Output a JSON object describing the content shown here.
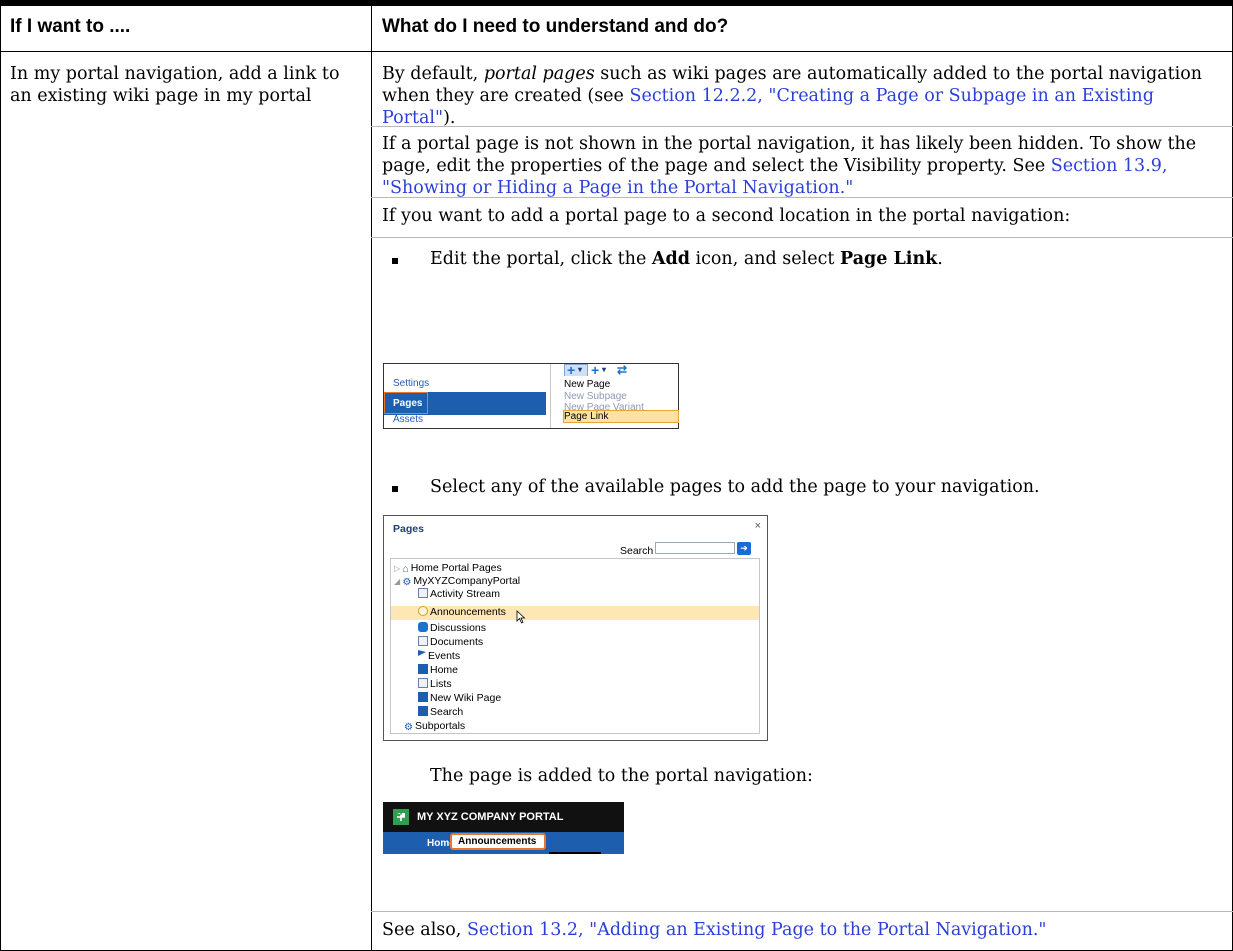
{
  "table": {
    "col1_header": "If I want to ....",
    "col2_header": "What do I need to understand and do?",
    "left_cell": "In my portal navigation, add a link to an existing wiki page in my portal"
  },
  "p1": {
    "pre": "By default, ",
    "em": "portal pages",
    "mid": " such as wiki pages are automatically added to the portal navigation when they are created (see ",
    "link": "Section 12.2.2, \"Creating a Page or Subpage in an Existing Portal\"",
    "post": ")."
  },
  "p2": {
    "pre": "If a portal page is not shown in the portal navigation, it has likely been hidden. To show the page, edit the properties of the page and select the Visibility property. See ",
    "link": "Section 13.9, \"Showing or Hiding a Page in the Portal Navigation.\""
  },
  "p3": {
    "text": "If you want to add a portal page to a second location in the portal navigation:"
  },
  "bullet1": {
    "pre": "Edit the portal, click the ",
    "b1": "Add",
    "mid": " icon, and select ",
    "b2": "Page Link",
    "post": "."
  },
  "shot1": {
    "nav": [
      "Settings",
      "Pages",
      "Assets"
    ],
    "menu": [
      "New Page",
      "New Subpage",
      "New Page Variant",
      "Page Link"
    ]
  },
  "bullet2": {
    "text": "Select any of the available pages to add the page to your navigation."
  },
  "shot2": {
    "title": "Pages",
    "close": "×",
    "search_label": "Search",
    "tree": [
      {
        "label": "Home Portal Pages",
        "icon": "home-icon"
      },
      {
        "label": "MyXYZCompanyPortal",
        "icon": "portal-icon"
      },
      {
        "label": "Activity Stream",
        "icon": "activity-stream-icon"
      },
      {
        "label": "Announcements",
        "icon": "announcements-icon"
      },
      {
        "label": "Discussions",
        "icon": "discussions-icon"
      },
      {
        "label": "Documents",
        "icon": "documents-icon"
      },
      {
        "label": "Events",
        "icon": "events-icon"
      },
      {
        "label": "Home",
        "icon": "page-icon"
      },
      {
        "label": "Lists",
        "icon": "lists-icon"
      },
      {
        "label": "New Wiki Page",
        "icon": "page-icon"
      },
      {
        "label": "Search",
        "icon": "page-icon"
      },
      {
        "label": "Subportals",
        "icon": "subportals-icon"
      }
    ]
  },
  "p4": {
    "text": "The page is added to the portal navigation:"
  },
  "shot3": {
    "brand": "MY XYZ COMPANY PORTAL",
    "tabs": [
      "Home",
      "Announcements"
    ]
  },
  "p5": {
    "pre": "See also, ",
    "link": "Section 13.2, \"Adding an Existing Page to the Portal Navigation.\""
  }
}
